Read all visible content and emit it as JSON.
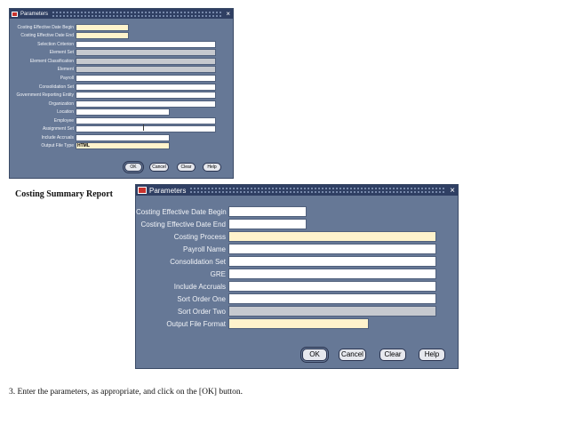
{
  "dialog_small": {
    "title": "Parameters",
    "close_glyph": "×",
    "fields": [
      {
        "label": "Costing Effective Date Begin",
        "value": ""
      },
      {
        "label": "Costing Effective Date End",
        "value": ""
      },
      {
        "label": "Selection Criterion",
        "value": ""
      },
      {
        "label": "Element Set",
        "value": ""
      },
      {
        "label": "Element Classification",
        "value": ""
      },
      {
        "label": "Element",
        "value": ""
      },
      {
        "label": "Payroll",
        "value": ""
      },
      {
        "label": "Consolidation Set",
        "value": ""
      },
      {
        "label": "Government Reporting Entity",
        "value": ""
      },
      {
        "label": "Organization",
        "value": ""
      },
      {
        "label": "Location",
        "value": ""
      },
      {
        "label": "Employee",
        "value": ""
      },
      {
        "label": "Assignment Set",
        "value": ""
      },
      {
        "label": "Include Accruals",
        "value": ""
      },
      {
        "label": "Output File Type",
        "value": "HTML"
      }
    ],
    "buttons": {
      "ok": "OK",
      "cancel": "Cancel",
      "clear": "Clear",
      "help": "Help"
    }
  },
  "section_heading": "Costing Summary Report",
  "dialog_large": {
    "title": "Parameters",
    "close_glyph": "×",
    "fields": [
      {
        "label": "Costing Effective Date Begin",
        "value": ""
      },
      {
        "label": "Costing Effective Date End",
        "value": ""
      },
      {
        "label": "Costing Process",
        "value": ""
      },
      {
        "label": "Payroll Name",
        "value": ""
      },
      {
        "label": "Consolidation Set",
        "value": ""
      },
      {
        "label": "GRE",
        "value": ""
      },
      {
        "label": "Include Accruals",
        "value": ""
      },
      {
        "label": "Sort Order One",
        "value": ""
      },
      {
        "label": "Sort Order Two",
        "value": ""
      },
      {
        "label": "Output File Format",
        "value": ""
      }
    ],
    "buttons": {
      "ok": "OK",
      "cancel": "Cancel",
      "clear": "Clear",
      "help": "Help"
    }
  },
  "instruction": "3. Enter the parameters, as appropriate, and click on the [OK] button."
}
